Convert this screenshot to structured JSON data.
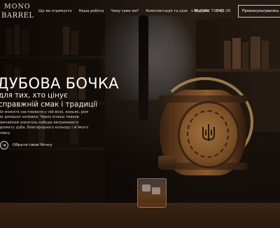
{
  "logo": {
    "line1": "MONO",
    "line2": "BARREL"
  },
  "nav": {
    "items": [
      {
        "label": "Що ви отримуєте"
      },
      {
        "label": "Наша робота"
      },
      {
        "label": "Чому саме ми?"
      },
      {
        "label": "Комплектація та ціни"
      },
      {
        "label": "Відгуки"
      },
      {
        "label": "FAQ"
      }
    ],
    "phone": "+38 (096) 733-43-20",
    "consult_button": "Проконсультуватись"
  },
  "hero": {
    "title": "ДУБОВА БОЧКА",
    "subtitle": "для тих, хто цінує справжній смак і традиції",
    "description": "Ви можете настоювати у ній віскі, коньяк, ром чи домашні наливки. Через кілька тижнів звичайний алкоголь набуде витриманого аромату дуба, благородного кольору і м'якого смаку.",
    "cta_label": "Обрати свою бочку"
  },
  "colors": {
    "background": "#120c08",
    "text": "#ffffff",
    "button_border": "#cfc6bb"
  }
}
